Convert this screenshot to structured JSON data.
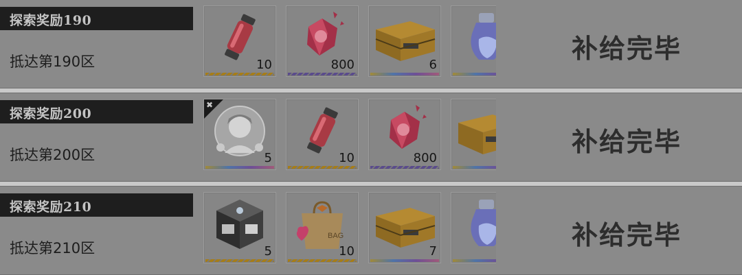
{
  "rewards": [
    {
      "title": "探索奖励190",
      "condition": "抵达第190区",
      "status": "补给完毕",
      "items": [
        {
          "icon": "red-canister-icon",
          "quantity": "10",
          "rarity": "gold"
        },
        {
          "icon": "red-crystal-icon",
          "quantity": "800",
          "rarity": "purple"
        },
        {
          "icon": "supply-crate-icon",
          "quantity": "6",
          "rarity": "rainbow"
        },
        {
          "icon": "potion-flask-icon",
          "quantity": "",
          "rarity": "rainbow"
        }
      ]
    },
    {
      "title": "探索奖励200",
      "condition": "抵达第200区",
      "status": "补给完毕",
      "items": [
        {
          "icon": "character-portrait-icon",
          "quantity": "5",
          "rarity": "rainbow"
        },
        {
          "icon": "red-canister-icon",
          "quantity": "10",
          "rarity": "gold"
        },
        {
          "icon": "red-crystal-icon",
          "quantity": "800",
          "rarity": "purple"
        },
        {
          "icon": "supply-crate-icon",
          "quantity": "",
          "rarity": "rainbow"
        }
      ]
    },
    {
      "title": "探索奖励210",
      "condition": "抵达第210区",
      "status": "补给完毕",
      "items": [
        {
          "icon": "metal-cube-icon",
          "quantity": "5",
          "rarity": "gold"
        },
        {
          "icon": "gift-bag-icon",
          "quantity": "10",
          "rarity": "gold"
        },
        {
          "icon": "supply-crate-icon",
          "quantity": "7",
          "rarity": "rainbow"
        },
        {
          "icon": "potion-flask-icon",
          "quantity": "",
          "rarity": "rainbow"
        }
      ]
    }
  ],
  "colors": {
    "panel": "#8a8a8a",
    "title_bar": "#1e1e1e",
    "title_text": "#c4c4c4",
    "status_text": "#2d2d2d"
  }
}
